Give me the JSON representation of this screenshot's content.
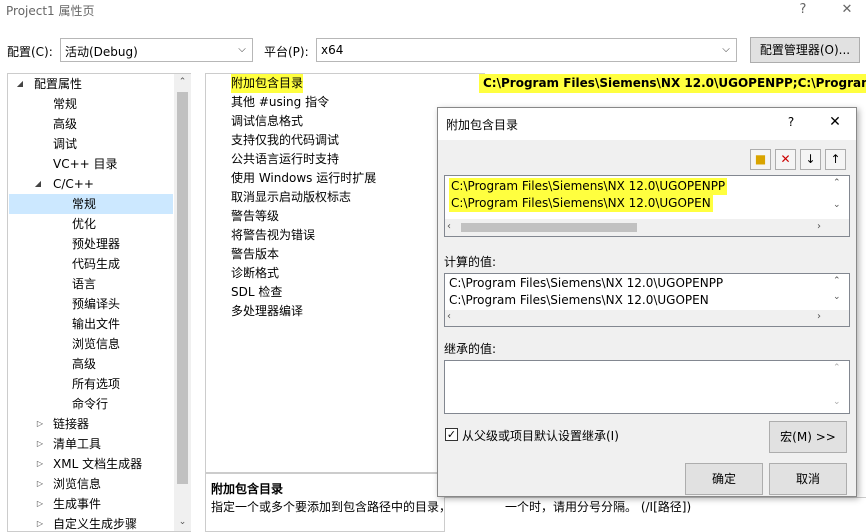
{
  "window": {
    "title": "Project1 属性页",
    "help": "?",
    "close": "✕"
  },
  "toolbar": {
    "config_label": "配置(C):",
    "config_value": "活动(Debug)",
    "platform_label": "平台(P):",
    "platform_value": "x64",
    "config_manager": "配置管理器(O)..."
  },
  "tree": {
    "items": [
      {
        "label": "配置属性",
        "expander": "◢"
      },
      {
        "label": "常规"
      },
      {
        "label": "高级"
      },
      {
        "label": "调试"
      },
      {
        "label": "VC++ 目录"
      },
      {
        "label": "C/C++",
        "expander": "◢"
      },
      {
        "label": "常规"
      },
      {
        "label": "优化"
      },
      {
        "label": "预处理器"
      },
      {
        "label": "代码生成"
      },
      {
        "label": "语言"
      },
      {
        "label": "预编译头"
      },
      {
        "label": "输出文件"
      },
      {
        "label": "浏览信息"
      },
      {
        "label": "高级"
      },
      {
        "label": "所有选项"
      },
      {
        "label": "命令行"
      },
      {
        "label": "链接器",
        "expander": "▷"
      },
      {
        "label": "清单工具",
        "expander": "▷"
      },
      {
        "label": "XML 文档生成器",
        "expander": "▷"
      },
      {
        "label": "浏览信息",
        "expander": "▷"
      },
      {
        "label": "生成事件",
        "expander": "▷"
      },
      {
        "label": "自定义生成步骤",
        "expander": "▷"
      }
    ]
  },
  "grid": {
    "rows": [
      "附加包含目录",
      "其他 #using 指令",
      "调试信息格式",
      "支持仅我的代码调试",
      "公共语言运行时支持",
      "使用 Windows 运行时扩展",
      "取消显示启动版权标志",
      "警告等级",
      "将警告视为错误",
      "警告版本",
      "诊断格式",
      "SDL 检查",
      "多处理器编译"
    ],
    "value_0": "C:\\Program Files\\Siemens\\NX 12.0\\UGOPENPP;C:\\Program Fil"
  },
  "description": {
    "title": "附加包含目录",
    "text": "指定一个或多个要添加到包含路径中的目录，"
  },
  "behind": {
    "desc_tail": "一个时，请用分号分隔。   (/I[路径])"
  },
  "dialog": {
    "title": "附加包含目录",
    "help": "?",
    "close": "✕",
    "paths": [
      "C:\\Program Files\\Siemens\\NX 12.0\\UGOPENPP",
      "C:\\Program Files\\Siemens\\NX 12.0\\UGOPEN"
    ],
    "computed_label": "计算的值:",
    "computed": [
      "C:\\Program Files\\Siemens\\NX 12.0\\UGOPENPP",
      "C:\\Program Files\\Siemens\\NX 12.0\\UGOPEN"
    ],
    "inherited_label": "继承的值:",
    "inherit_checkbox": "从父级或项目默认设置继承(I)",
    "inherit_checked": "✓",
    "macro_button": "宏(M) >>",
    "ok": "确定",
    "cancel": "取消"
  },
  "colors": {
    "highlight": "#ffff3f",
    "selection": "#cce8ff"
  }
}
